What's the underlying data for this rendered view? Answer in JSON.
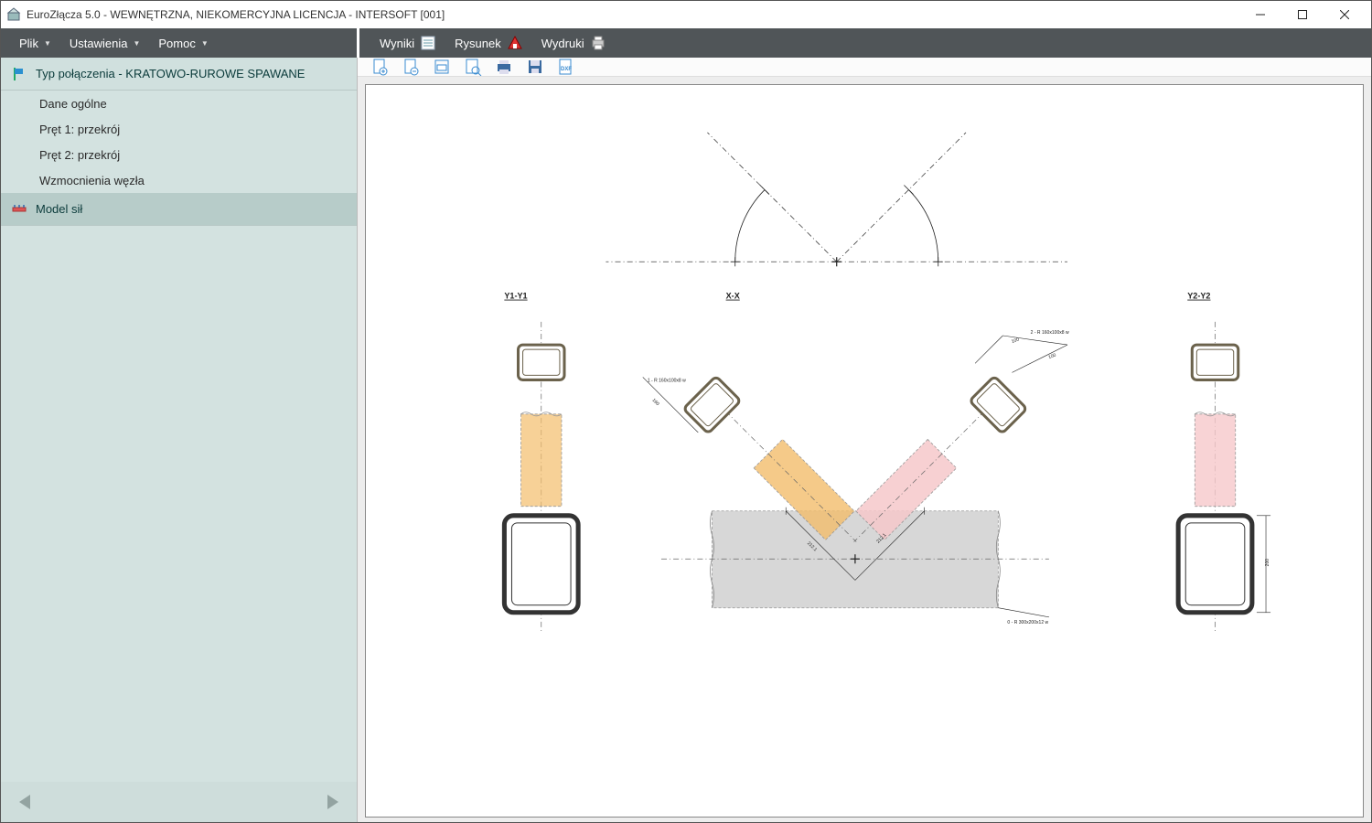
{
  "titlebar": {
    "title": "EuroZłącza 5.0 - WEWNĘTRZNA, NIEKOMERCYJNA LICENCJA - INTERSOFT [001]"
  },
  "menubar": {
    "left": [
      {
        "label": "Plik",
        "has_dropdown": true
      },
      {
        "label": "Ustawienia",
        "has_dropdown": true
      },
      {
        "label": "Pomoc",
        "has_dropdown": true
      }
    ],
    "right": [
      {
        "label": "Wyniki",
        "icon": "results-icon"
      },
      {
        "label": "Rysunek",
        "icon": "drawing-icon"
      },
      {
        "label": "Wydruki",
        "icon": "print-icon"
      }
    ]
  },
  "sidebar": {
    "head1": {
      "label": "Typ połączenia - KRATOWO-RUROWE SPAWANE"
    },
    "items1": [
      {
        "label": "Dane ogólne"
      },
      {
        "label": "Pręt 1: przekrój"
      },
      {
        "label": "Pręt 2: przekrój"
      },
      {
        "label": "Wzmocnienia węzła"
      }
    ],
    "head2": {
      "label": "Model sił"
    }
  },
  "toolbar": {
    "buttons": [
      "new-page",
      "remove-page",
      "page-magnify",
      "page-preview",
      "print",
      "save",
      "export-dxf"
    ]
  },
  "drawing": {
    "sections": {
      "y1": "Y1-Y1",
      "xx": "X-X",
      "y2": "Y2-Y2"
    },
    "labels": {
      "member0": "0 - R 300x200x12 w",
      "member1": "1 - R 160x100x8 w",
      "member2": "2 - R 160x100x8 w",
      "d100a": "100",
      "d100b": "100",
      "d160": "160",
      "d200": "200",
      "d212a": "212.1",
      "d212b": "212.1"
    }
  }
}
